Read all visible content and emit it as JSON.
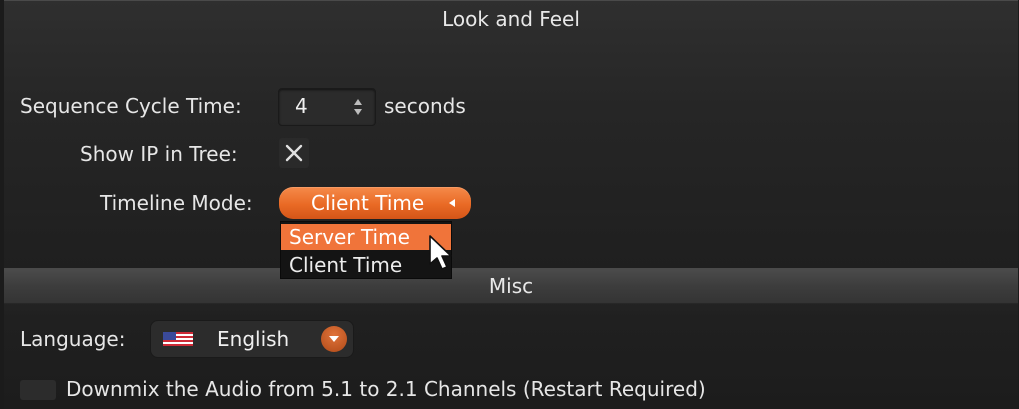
{
  "look_and_feel": {
    "title": "Look and Feel",
    "sequence_cycle_time": {
      "label": "Sequence Cycle Time:",
      "value": "4",
      "unit": "seconds"
    },
    "show_ip_in_tree": {
      "label": "Show IP in Tree:",
      "checked": true
    },
    "timeline_mode": {
      "label": "Timeline Mode:",
      "selected": "Client Time",
      "options": [
        "Server Time",
        "Client Time"
      ],
      "highlighted_option": "Server Time"
    }
  },
  "misc": {
    "title": "Misc",
    "language": {
      "label": "Language:",
      "selected": "English",
      "flag_icon": "us-flag-icon"
    },
    "downmix": {
      "label": "Downmix the Audio from 5.1 to 2.1 Channels (Restart Required)",
      "checked": false
    }
  },
  "colors": {
    "accent": "#ee6f2e",
    "highlight": "#f0743a",
    "background": "#262626"
  }
}
